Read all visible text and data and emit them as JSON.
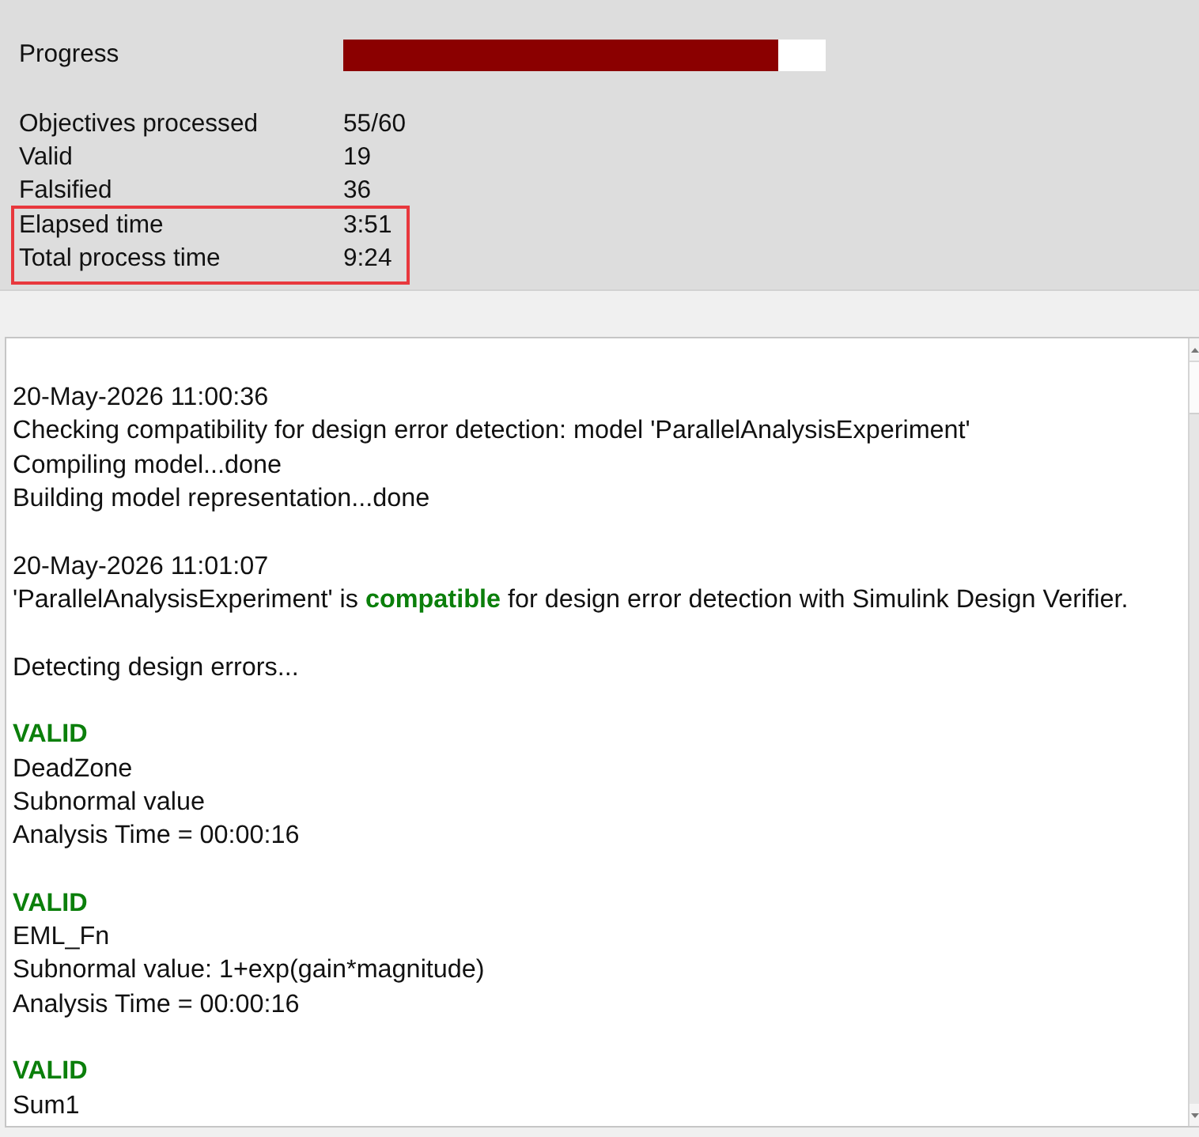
{
  "progress": {
    "label": "Progress",
    "level": 0.9
  },
  "stats": [
    {
      "label": "Objectives processed",
      "value": "55/60",
      "highlighted": false
    },
    {
      "label": "Valid",
      "value": "19",
      "highlighted": false
    },
    {
      "label": "Falsified",
      "value": "36",
      "highlighted": false
    },
    {
      "label": "Elapsed time",
      "value": "3:51",
      "highlighted": true
    },
    {
      "label": "Total process time",
      "value": "9:24",
      "highlighted": true
    }
  ],
  "log": [
    {
      "lines": [
        {
          "kind": "timestamp",
          "text": "20-May-2026 11:00:36"
        },
        {
          "kind": "text",
          "text": "Checking compatibility for design error detection: model 'ParallelAnalysisExperiment'"
        },
        {
          "kind": "text",
          "text": "Compiling model...done"
        },
        {
          "kind": "text",
          "text": "Building model representation...done"
        }
      ]
    },
    {
      "lines": [
        {
          "kind": "timestamp",
          "text": "20-May-2026 11:01:07"
        },
        {
          "kind": "text",
          "text": "'ParallelAnalysisExperiment' is **compatible** for design error detection with Simulink Design Verifier."
        }
      ]
    },
    {
      "lines": [
        {
          "kind": "text",
          "text": "Detecting design errors..."
        }
      ]
    },
    {
      "lines": [
        {
          "kind": "status",
          "text": "VALID"
        },
        {
          "kind": "text",
          "text": "DeadZone"
        },
        {
          "kind": "text",
          "text": "Subnormal value"
        },
        {
          "kind": "text",
          "text": "Analysis Time = 00:00:16"
        }
      ]
    },
    {
      "lines": [
        {
          "kind": "status",
          "text": "VALID"
        },
        {
          "kind": "text",
          "text": "EML_Fn"
        },
        {
          "kind": "text",
          "text": "Subnormal value: 1+exp(gain*magnitude)"
        },
        {
          "kind": "text",
          "text": "Analysis Time = 00:00:16"
        }
      ]
    },
    {
      "lines": [
        {
          "kind": "status",
          "text": "VALID"
        },
        {
          "kind": "text",
          "text": "Sum1"
        }
      ]
    }
  ]
}
